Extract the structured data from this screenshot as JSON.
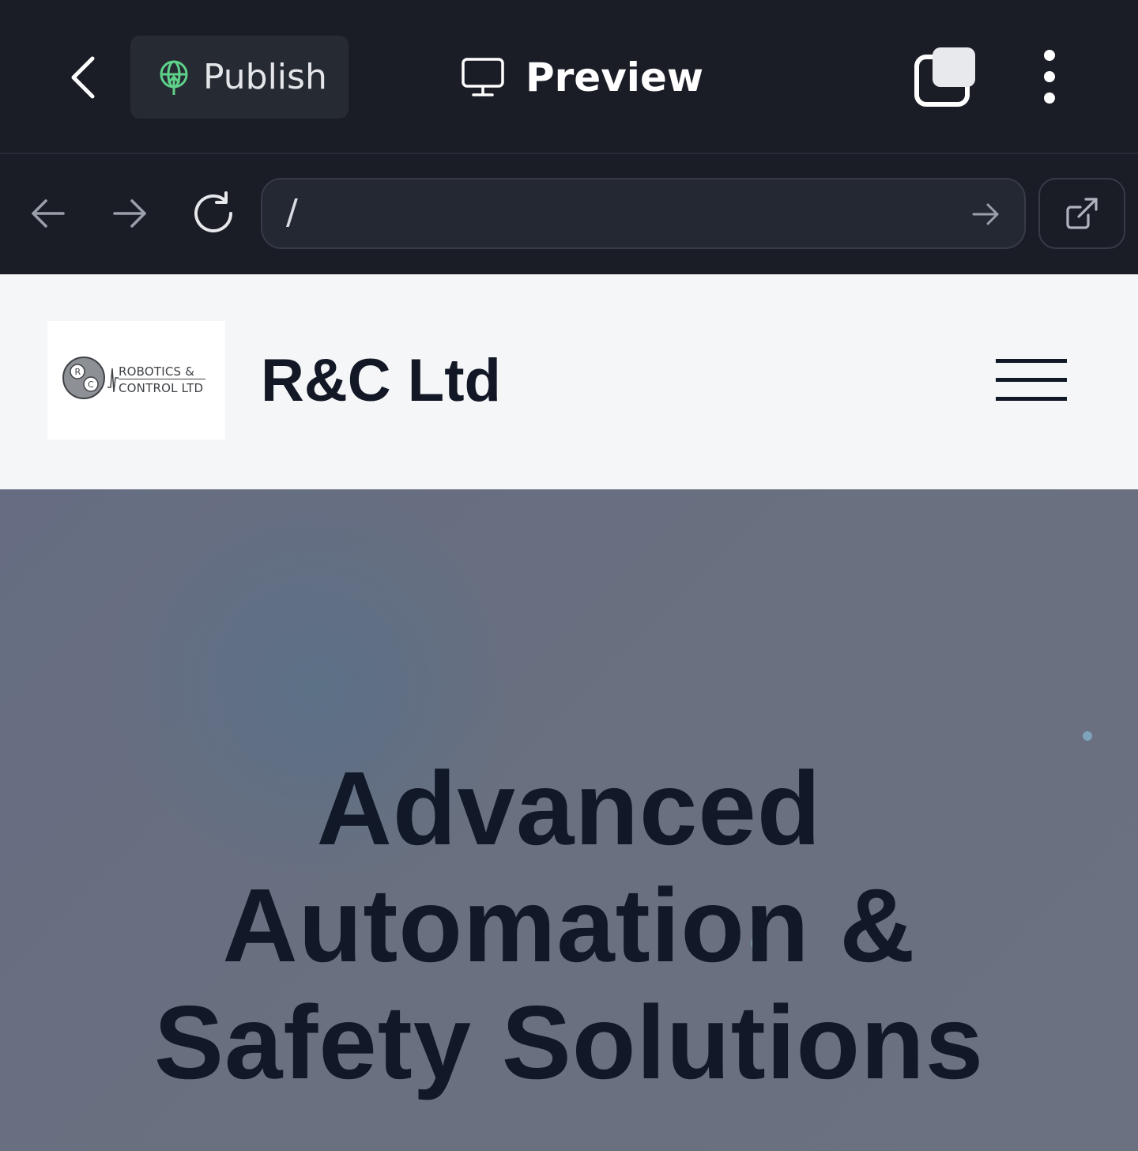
{
  "toolbar": {
    "publish_label": "Publish",
    "preview_label": "Preview",
    "icons": {
      "back": "chevron-left-icon",
      "publish": "globe-upload-icon",
      "preview": "monitor-icon",
      "tabs": "tabs-icon",
      "more": "more-vertical-icon"
    }
  },
  "address_bar": {
    "url": "/",
    "icons": [
      "arrow-left-icon",
      "arrow-right-icon",
      "refresh-icon",
      "go-arrow-icon",
      "external-link-icon"
    ]
  },
  "site": {
    "logo_line1": "ROBOTICS &",
    "logo_line2": "CONTROL LTD",
    "title": "R&C Ltd",
    "hero_lines": [
      "Advanced",
      "Automation &",
      "Safety Solutions"
    ]
  },
  "colors": {
    "chrome_bg": "#1a1d26",
    "publish_accent": "#5fd28a",
    "header_bg": "#f5f6f8",
    "hero_bg": "#69707f",
    "hero_text": "#111827"
  }
}
